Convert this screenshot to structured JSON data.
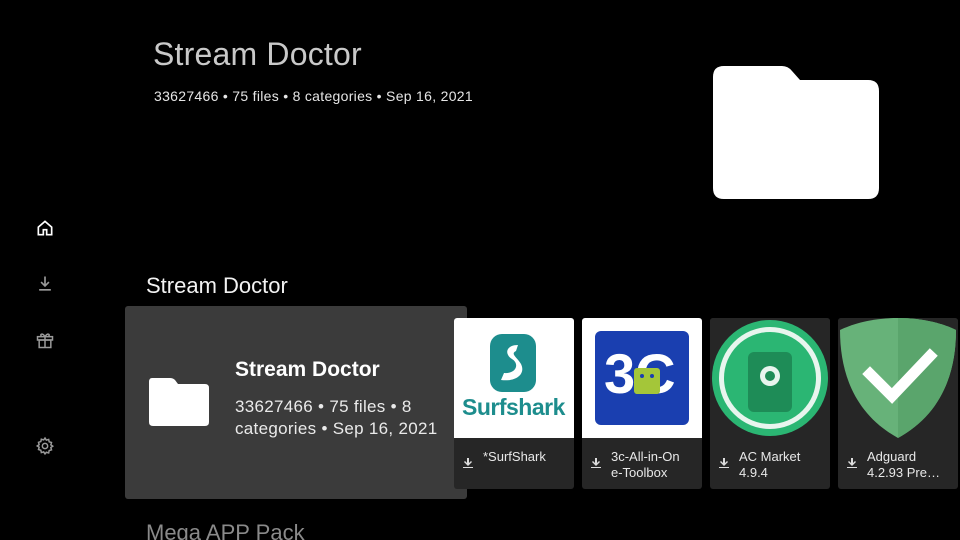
{
  "hero": {
    "title": "Stream Doctor",
    "meta": "33627466 • 75 files • 8 categories • Sep 16, 2021",
    "image_icon": "folder-icon"
  },
  "nav": {
    "items": [
      {
        "icon": "home-icon"
      },
      {
        "icon": "download-icon"
      },
      {
        "icon": "gift-icon"
      },
      {
        "icon": "gear-icon"
      }
    ]
  },
  "row": {
    "title": "Stream Doctor",
    "focused": {
      "title": "Stream Doctor",
      "meta": "33627466 • 75 files • 8 categories • Sep 16, 2021",
      "icon": "folder-icon"
    },
    "apps": [
      {
        "line1": "*SurfShark",
        "line2": "",
        "logo_text": "Surfshark"
      },
      {
        "line1": "3c-All-in-On",
        "line2": "e-Toolbox",
        "logo_text": "3C"
      },
      {
        "line1": "AC Market",
        "line2": "4.9.4"
      },
      {
        "line1": "Adguard",
        "line2": "4.2.93 Pre…"
      }
    ]
  },
  "row2": {
    "title": "Mega APP Pack"
  },
  "colors": {
    "background": "#000000",
    "focus_card": "#3b3b3b",
    "tile": "#262626",
    "surfshark_teal": "#1d8d8d",
    "three_c_blue": "#1a3fb0",
    "acmarket_green": "#2bb673",
    "adguard_green": "#67b279"
  }
}
